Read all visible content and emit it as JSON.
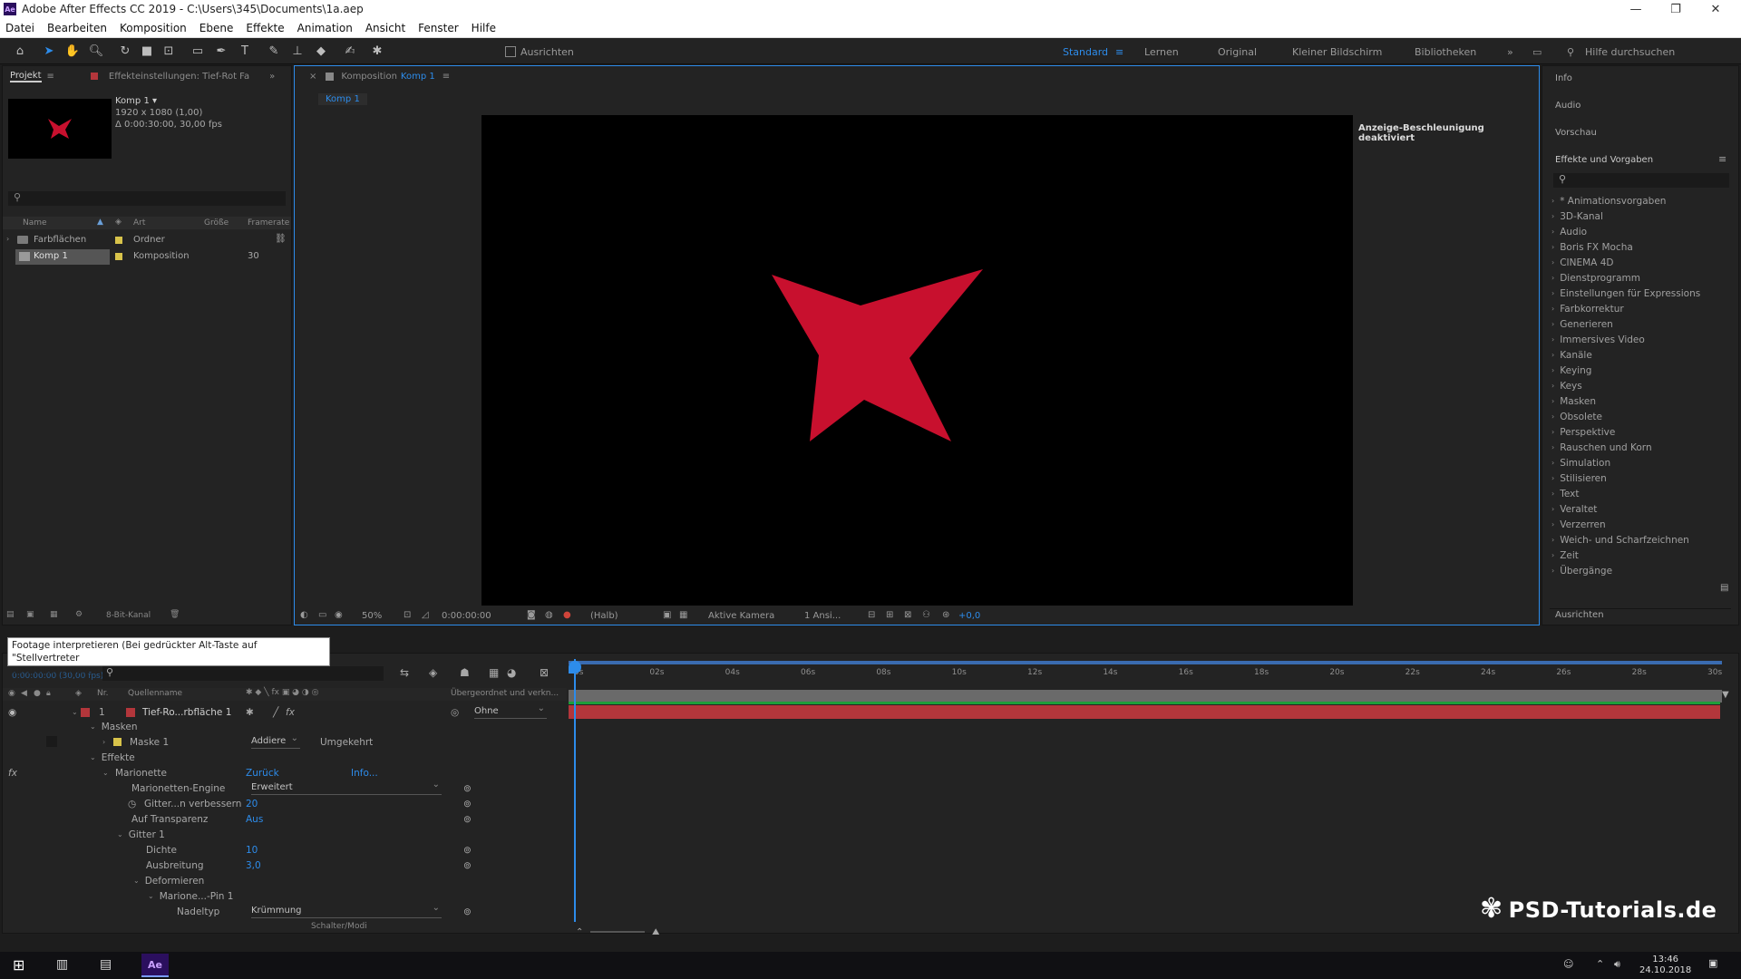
{
  "window": {
    "title": "Adobe After Effects CC 2019 - C:\\Users\\345\\Documents\\1a.aep",
    "minimize": "—",
    "maximize": "❐",
    "close": "✕"
  },
  "menu": [
    "Datei",
    "Bearbeiten",
    "Komposition",
    "Ebene",
    "Effekte",
    "Animation",
    "Ansicht",
    "Fenster",
    "Hilfe"
  ],
  "toolbar": {
    "ausrichten": "Ausrichten",
    "workspaces": [
      "Standard",
      "Lernen",
      "Original",
      "Kleiner Bildschirm",
      "Bibliotheken"
    ],
    "help_placeholder": "Hilfe durchsuchen"
  },
  "project": {
    "tab_project": "Projekt",
    "tab_effect": "Effekteinstellungen: Tief-Rot Fa",
    "item_name": "Komp 1 ▾",
    "item_size": "1920 x 1080 (1,00)",
    "item_duration": "Δ 0:00:30:00, 30,00 fps",
    "columns": [
      "Name",
      "Art",
      "Größe",
      "Framerate"
    ],
    "rows": [
      {
        "name": "Farbflächen",
        "type": "Ordner",
        "size": "",
        "fps": ""
      },
      {
        "name": "Komp 1",
        "type": "Komposition",
        "size": "",
        "fps": "30"
      }
    ],
    "bpc": "8-Bit-Kanal"
  },
  "composition": {
    "tab_label": "Komposition",
    "tab_name": "Komp 1",
    "sub_tab": "Komp 1",
    "gpu_notice": "Anzeige-Beschleunigung deaktiviert",
    "zoom": "50%",
    "timecode": "0:00:00:00",
    "resolution": "(Halb)",
    "camera": "Aktive Kamera",
    "views": "1 Ansi...",
    "exposure": "+0,0"
  },
  "right_panel": {
    "info": "Info",
    "audio": "Audio",
    "preview": "Vorschau",
    "effects_title": "Effekte und Vorgaben",
    "effects": [
      "* Animationsvorgaben",
      "3D-Kanal",
      "Audio",
      "Boris FX Mocha",
      "CINEMA 4D",
      "Dienstprogramm",
      "Einstellungen für Expressions",
      "Farbkorrektur",
      "Generieren",
      "Immersives Video",
      "Kanäle",
      "Keying",
      "Keys",
      "Masken",
      "Obsolete",
      "Perspektive",
      "Rauschen und Korn",
      "Simulation",
      "Stilisieren",
      "Text",
      "Veraltet",
      "Verzerren",
      "Weich- und Scharfzeichnen",
      "Zeit",
      "Übergänge"
    ],
    "align": "Ausrichten"
  },
  "tooltip": {
    "line1": "Footage interpretieren (Bei gedrückter Alt-Taste auf \"Stellvertreter",
    "line2": "einstellen\" klicken)"
  },
  "timeline": {
    "timecode": "0:00:00:00 (30,00 fps)",
    "col_source": "Quellenname",
    "col_nr": "Nr.",
    "col_parent": "Übergeordnet und verkn...",
    "layer_nr": "1",
    "layer_name": "Tief-Ro...rbfläche 1",
    "parent": "Ohne",
    "masks": "Masken",
    "mask1": "Maske 1",
    "mask_mode": "Addiere",
    "inverted": "Umgekehrt",
    "effects": "Effekte",
    "marionette": "Marionette",
    "reset": "Zurück",
    "info": "Info...",
    "engine_label": "Marionetten-Engine",
    "engine_value": "Erweitert",
    "mesh_label": "Gitter...n verbessern",
    "mesh_value": "20",
    "transparency_label": "Auf Transparenz",
    "transparency_value": "Aus",
    "grid1": "Gitter 1",
    "density_label": "Dichte",
    "density_value": "10",
    "expansion_label": "Ausbreitung",
    "expansion_value": "3,0",
    "deform": "Deformieren",
    "pin": "Marione...-Pin 1",
    "pintype_label": "Nadeltyp",
    "pintype_value": "Krümmung",
    "switches_modes": "Schalter/Modi",
    "ruler": [
      "0s",
      "02s",
      "04s",
      "06s",
      "08s",
      "10s",
      "12s",
      "14s",
      "16s",
      "18s",
      "20s",
      "22s",
      "24s",
      "26s",
      "28s",
      "30s"
    ]
  },
  "watermark": "PSD-Tutorials.de",
  "taskbar": {
    "time": "13:46",
    "date": "24.10.2018",
    "ae": "Ae"
  },
  "colors": {
    "accent": "#2d8ceb",
    "star": "#c8102e",
    "layer_bar": "#b3363b",
    "green_bar": "#1e9e3a"
  }
}
